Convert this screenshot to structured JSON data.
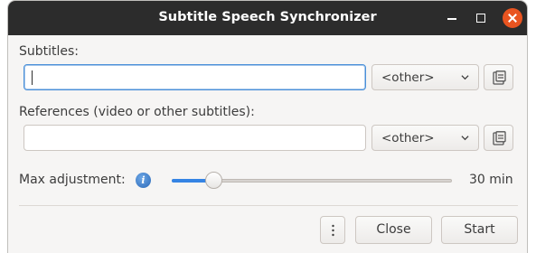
{
  "window": {
    "title": "Subtitle Speech Synchronizer",
    "controls": [
      "minimize-icon",
      "maximize-icon",
      "close-icon"
    ],
    "close_color": "#e95420"
  },
  "subtitles": {
    "label": "Subtitles:",
    "value": "",
    "placeholder": "",
    "format": "<other>"
  },
  "references": {
    "label": "References (video or other subtitles):",
    "value": "",
    "placeholder": "",
    "format": "<other>"
  },
  "max_adjustment": {
    "label": "Max adjustment:",
    "value_text": "30 min",
    "slider_fraction": 0.15,
    "accent": "#3584e4"
  },
  "footer": {
    "menu_icon": "vertical-dots-icon",
    "close_label": "Close",
    "start_label": "Start"
  }
}
